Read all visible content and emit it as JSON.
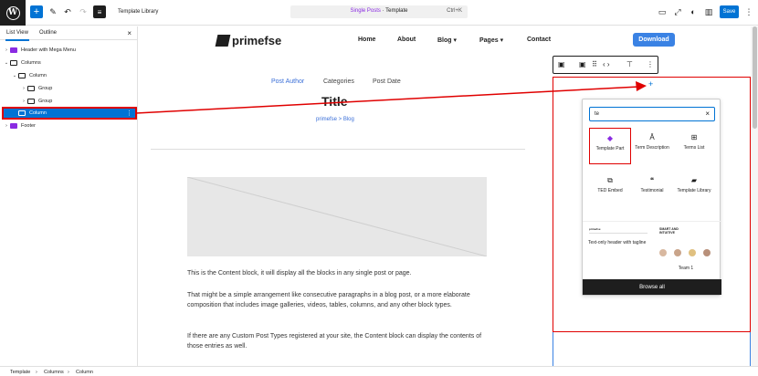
{
  "topbar": {
    "doc_title": "Template Library",
    "command_prefix": "Single Posts",
    "command_suffix": " · Template",
    "shortcut": "Ctrl+K",
    "save_label": "Save"
  },
  "listview": {
    "tabs": [
      "List View",
      "Outline"
    ],
    "rows": [
      {
        "label": "Header with Mega Menu"
      },
      {
        "label": "Columns"
      },
      {
        "label": "Column"
      },
      {
        "label": "Group"
      },
      {
        "label": "Group"
      },
      {
        "label": "Column"
      },
      {
        "label": "Footer"
      }
    ]
  },
  "canvas": {
    "logo": "primefse",
    "nav": [
      "Home",
      "About",
      "Blog ▾",
      "Pages ▾",
      "Contact"
    ],
    "download": "Download",
    "meta": [
      "Post Author",
      "Categories",
      "Post Date"
    ],
    "post_title": "Title",
    "breadcrumb": "primefse > Blog",
    "paragraphs": [
      "This is the Content block, it will display all the blocks in any single post or page.",
      "That might be a simple arrangement like consecutive paragraphs in a blog post, or a more elaborate composition that includes image galleries, videos, tables, columns, and any other block types.",
      "If there are any Custom Post Types registered at your site, the Content block can display the contents of those entries as well."
    ]
  },
  "inserter": {
    "search_value": "te",
    "blocks": [
      {
        "label": "Template Part",
        "icon": "◆"
      },
      {
        "label": "Term Description",
        "icon": "Ā"
      },
      {
        "label": "Terms List",
        "icon": "⊞"
      },
      {
        "label": "TED Embed",
        "icon": "⧉"
      },
      {
        "label": "Testimonial",
        "icon": "❝"
      },
      {
        "label": "Template Library",
        "icon": "▰"
      }
    ],
    "pattern1": {
      "brand": "primefse",
      "caption": "Text-only header with tagline"
    },
    "pattern2": {
      "title": "SMART AND INTUITIVE",
      "caption": "Team 1"
    },
    "browse_all": "Browse all"
  },
  "statusbar": [
    "Template",
    "Columns",
    "Column"
  ],
  "colors": {
    "accent": "#0073d4",
    "highlight": "#e00000",
    "purple": "#8a2be2"
  }
}
